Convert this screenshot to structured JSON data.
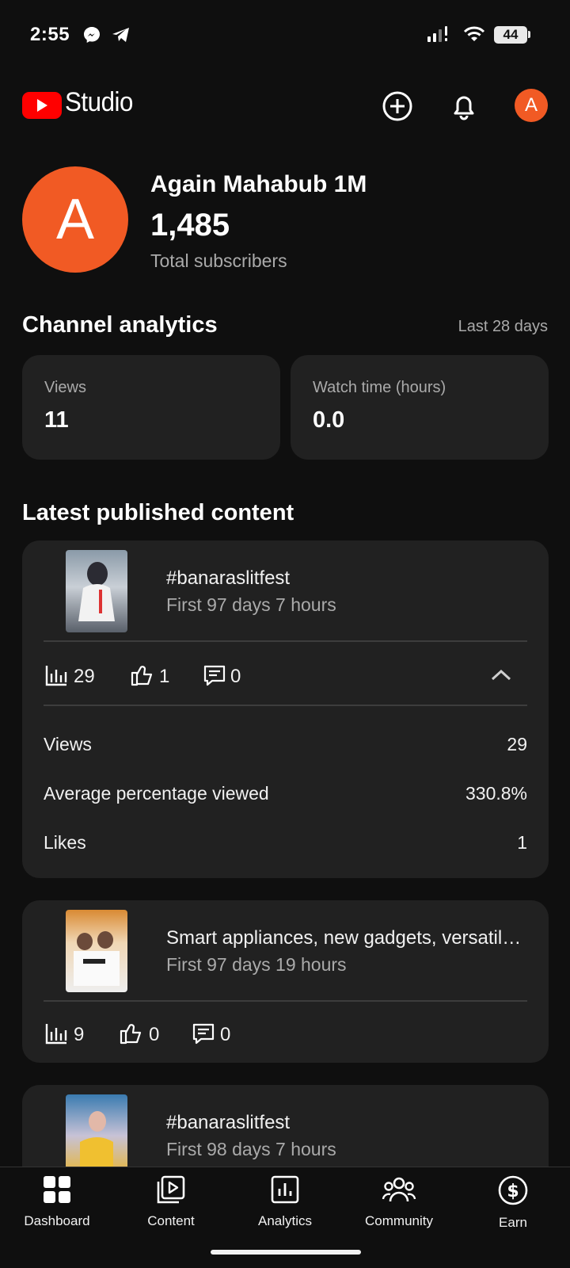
{
  "status": {
    "time": "2:55",
    "battery": "44",
    "icons": [
      "messenger-icon",
      "telegram-icon",
      "signal-icon",
      "wifi-icon",
      "battery-icon"
    ]
  },
  "header": {
    "brand": "Studio",
    "avatar_letter": "A",
    "icons": [
      "youtube-logo-icon",
      "create-icon",
      "bell-icon"
    ]
  },
  "channel": {
    "avatar_letter": "A",
    "name": "Again Mahabub 1M",
    "subscribers": "1,485",
    "subscribers_label": "Total subscribers"
  },
  "analytics": {
    "title": "Channel analytics",
    "period": "Last 28 days",
    "metrics": [
      {
        "label": "Views",
        "value": "11"
      },
      {
        "label": "Watch time (hours)",
        "value": "0.0"
      }
    ]
  },
  "latest": {
    "title": "Latest published content",
    "items": [
      {
        "title": "#banaraslitfest",
        "subtitle": "First 97 days 7 hours",
        "views": "29",
        "likes": "1",
        "comments": "0",
        "expanded": true,
        "details": [
          {
            "label": "Views",
            "value": "29"
          },
          {
            "label": "Average percentage viewed",
            "value": "330.8%"
          },
          {
            "label": "Likes",
            "value": "1"
          }
        ]
      },
      {
        "title": "Smart appliances, new gadgets, versatil…",
        "subtitle": "First 97 days 19 hours",
        "views": "9",
        "likes": "0",
        "comments": "0"
      },
      {
        "title": "#banaraslitfest",
        "subtitle": "First 98 days 7 hours"
      }
    ]
  },
  "nav": {
    "items": [
      {
        "label": "Dashboard",
        "icon": "dashboard-icon"
      },
      {
        "label": "Content",
        "icon": "content-icon"
      },
      {
        "label": "Analytics",
        "icon": "analytics-icon"
      },
      {
        "label": "Community",
        "icon": "community-icon"
      },
      {
        "label": "Earn",
        "icon": "earn-icon"
      }
    ]
  },
  "colors": {
    "background": "#0f0f0f",
    "card": "#212121",
    "accent_avatar": "#f15a24",
    "youtube_red": "#ff0000",
    "muted_text": "#aaaaaa"
  }
}
